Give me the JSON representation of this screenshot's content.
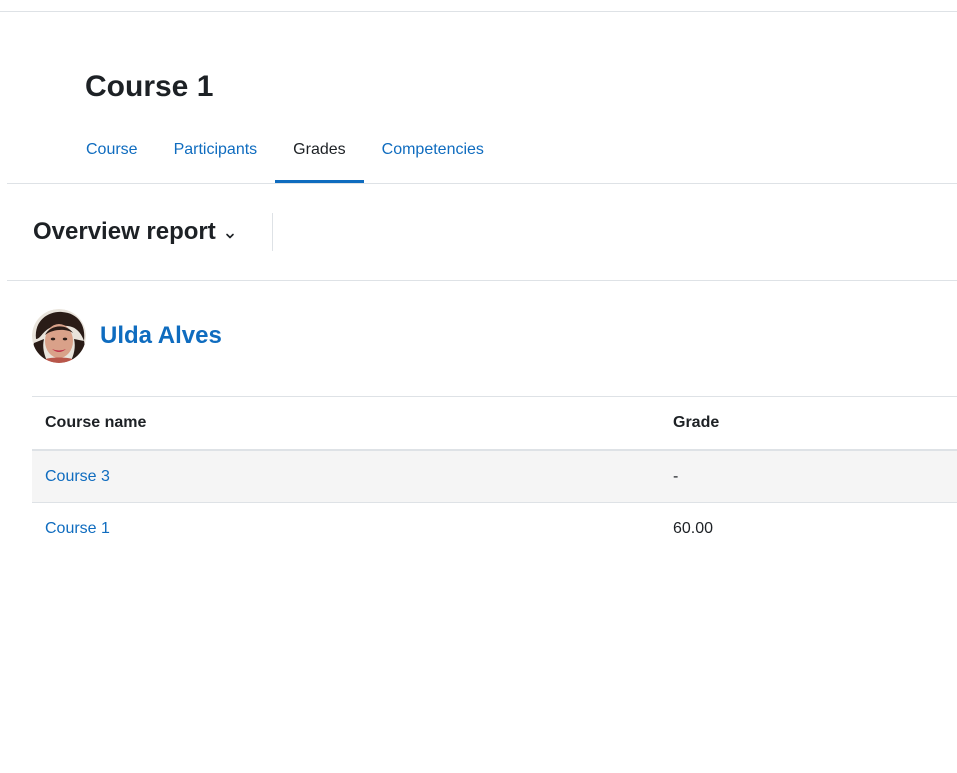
{
  "page": {
    "title": "Course 1"
  },
  "nav": {
    "tabs": [
      {
        "label": "Course",
        "active": false
      },
      {
        "label": "Participants",
        "active": false
      },
      {
        "label": "Grades",
        "active": true
      },
      {
        "label": "Competencies",
        "active": false
      }
    ]
  },
  "report_selector": {
    "label": "Overview report",
    "icon": "chevron-down-icon"
  },
  "user": {
    "name": "Ulda Alves",
    "avatar": "user-avatar"
  },
  "table": {
    "headers": {
      "course_name": "Course name",
      "grade": "Grade"
    },
    "rows": [
      {
        "course": "Course 3",
        "grade": "-"
      },
      {
        "course": "Course 1",
        "grade": "60.00"
      }
    ]
  },
  "colors": {
    "link": "#0f6cbf",
    "text": "#1d2125",
    "border": "#dee2e6",
    "stripe": "#f5f5f5"
  }
}
